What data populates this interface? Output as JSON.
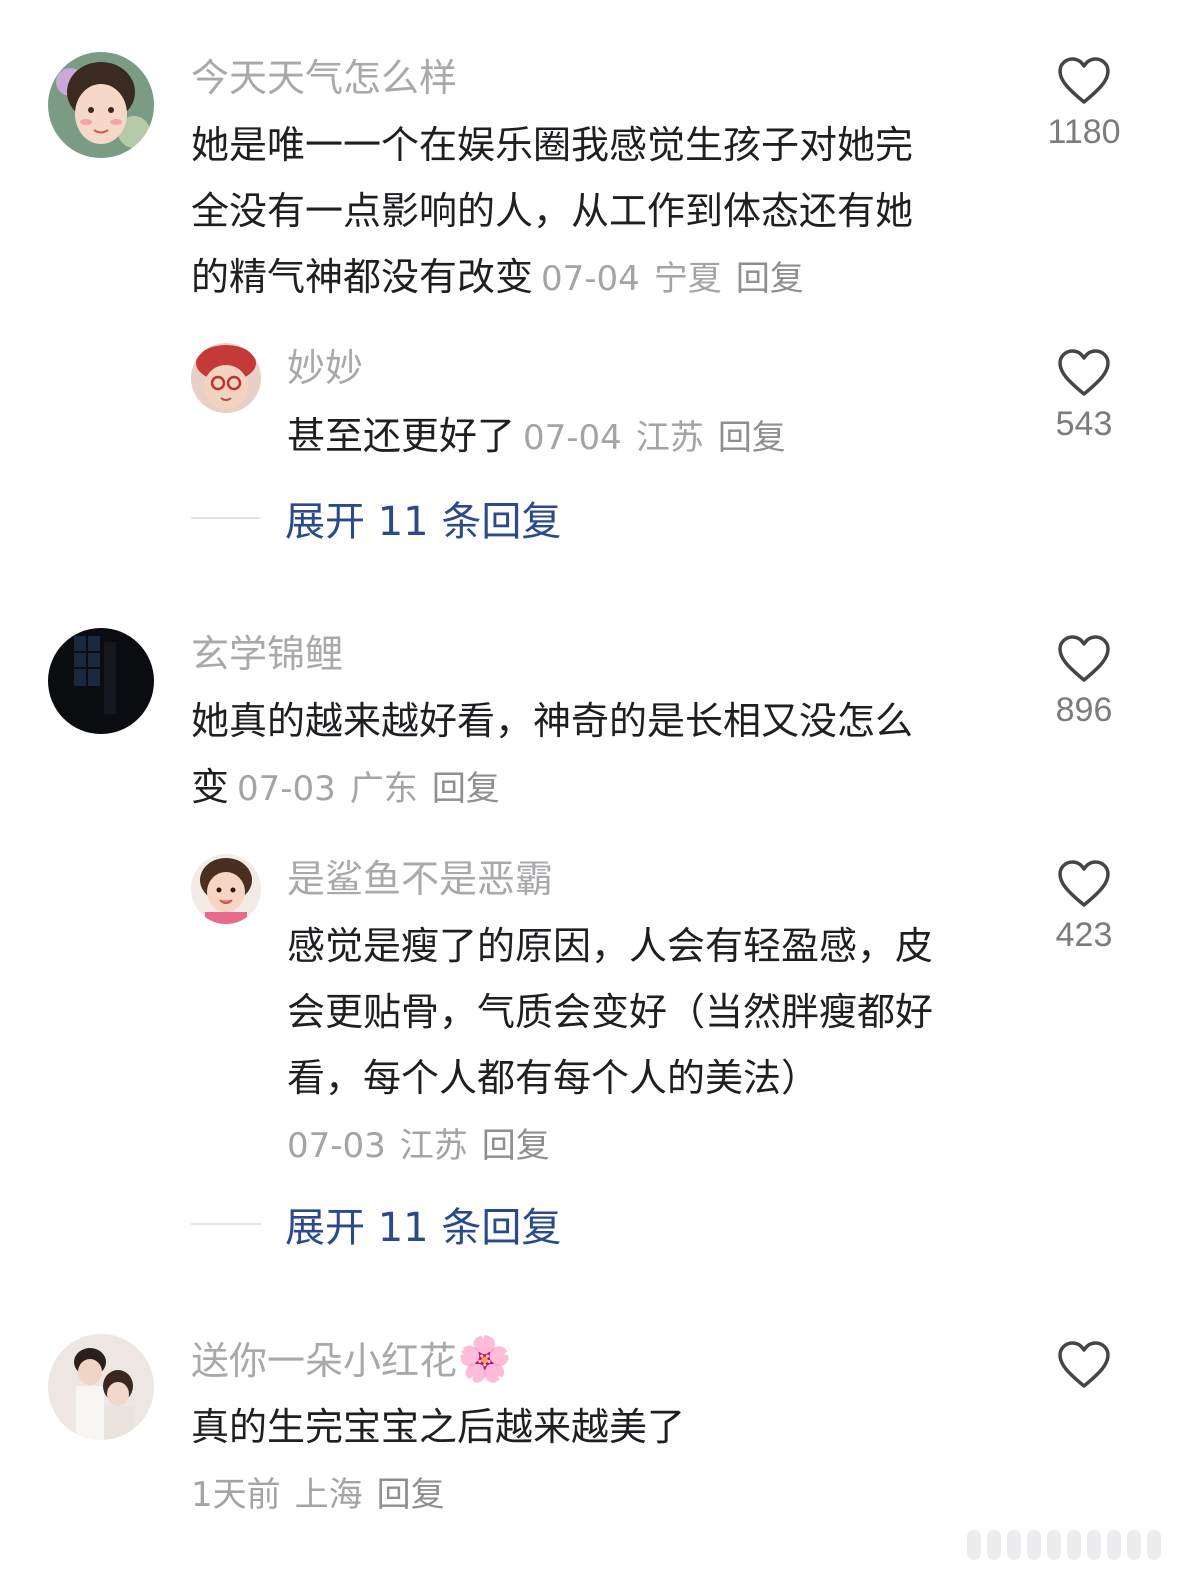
{
  "colors": {
    "username": "#a8a8ad",
    "text": "#1f1f23",
    "meta": "#a3a3a8",
    "expand": "#2a4a8c",
    "count": "#7b7b80"
  },
  "comments": [
    {
      "username": "今天天气怎么样",
      "lines": [
        "她是唯一一个在娱乐圈我感觉生孩子对她完",
        "全没有一点影响的人，从工作到体态还有她",
        "的精气神都没有改变"
      ],
      "date": "07-04",
      "location": "宁夏",
      "reply": "回复",
      "likes": "1180",
      "replies": [
        {
          "username": "妙妙",
          "lines": [
            "甚至还更好了"
          ],
          "date": "07-04",
          "location": "江苏",
          "reply": "回复",
          "likes": "543"
        }
      ],
      "expand": "展开 11 条回复"
    },
    {
      "username": "玄学锦鲤",
      "lines": [
        "她真的越来越好看，神奇的是长相又没怎么",
        "变"
      ],
      "date": "07-03",
      "location": "广东",
      "reply": "回复",
      "likes": "896",
      "replies": [
        {
          "username": "是鲨鱼不是恶霸",
          "lines": [
            "感觉是瘦了的原因，人会有轻盈感，皮",
            "会更贴骨，气质会变好（当然胖瘦都好",
            "看，每个人都有每个人的美法）"
          ],
          "date": "07-03",
          "location": "江苏",
          "reply": "回复",
          "likes": "423"
        }
      ],
      "expand": "展开 11 条回复"
    },
    {
      "username": "送你一朵小红花",
      "username_emoji": "🌸",
      "lines": [
        "真的生完宝宝之后越来越美了"
      ],
      "date": "1天前",
      "location": "上海",
      "reply": "回复",
      "likes": ""
    }
  ]
}
